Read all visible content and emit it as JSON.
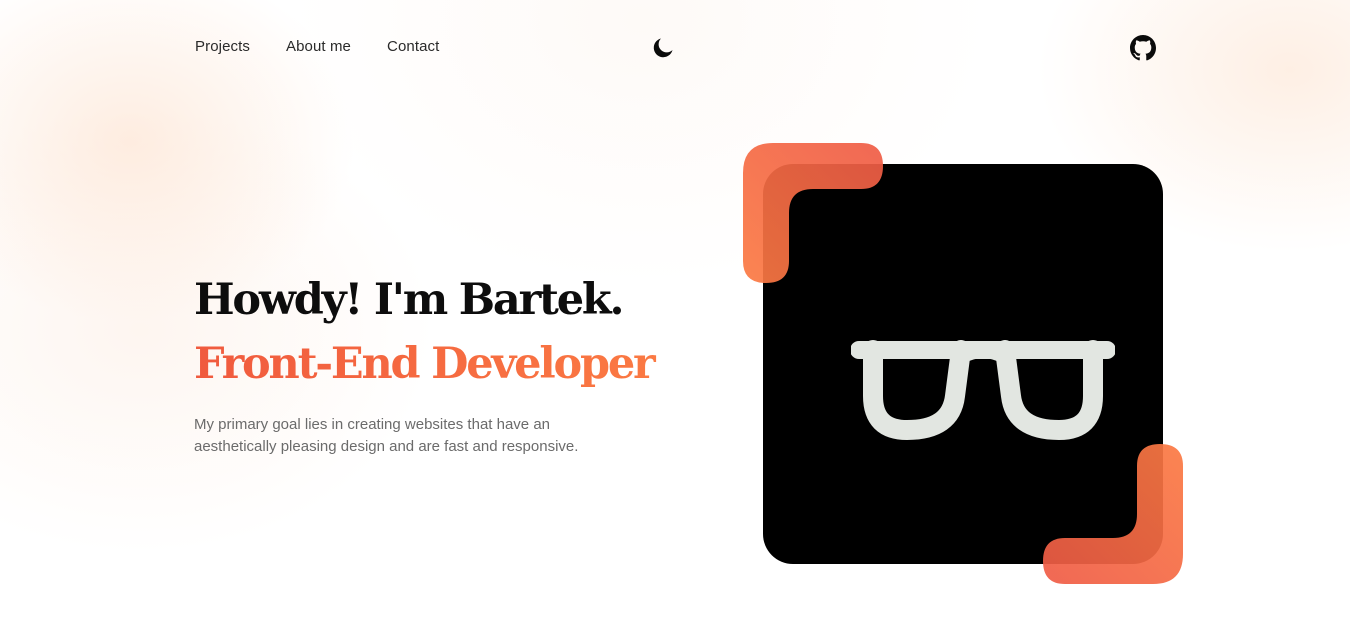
{
  "nav": {
    "links": [
      {
        "label": "Projects"
      },
      {
        "label": "About me"
      },
      {
        "label": "Contact"
      }
    ],
    "theme_toggle_icon": "moon-icon",
    "github_icon": "github-icon"
  },
  "hero": {
    "title": "Howdy! I'm Bartek.",
    "subtitle": "Front-End Developer",
    "description": "My primary goal lies in creating websites that have an aesthetically pleasing design and are fast and responsive."
  },
  "avatar": {
    "icon": "glasses-icon",
    "card_color": "#000000",
    "glasses_color": "#e2e6e1"
  },
  "colors": {
    "accent_start": "#f05a3e",
    "accent_end": "#fb7a43",
    "text_dark": "#0d0d0d",
    "text_muted": "#6b6b6b"
  }
}
